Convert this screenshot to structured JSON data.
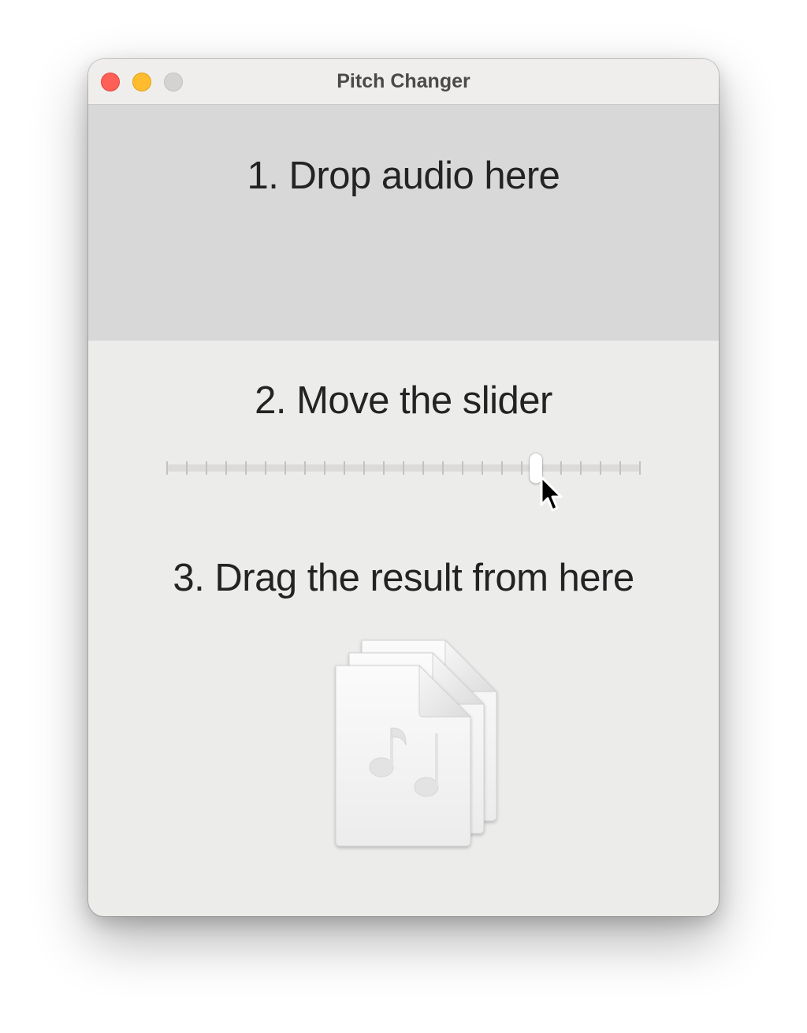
{
  "window": {
    "title": "Pitch Changer"
  },
  "dropzone": {
    "label": "1. Drop audio here"
  },
  "slider_section": {
    "label": "2. Move the slider",
    "tick_count": 25,
    "value_fraction": 0.78
  },
  "result_section": {
    "label": "3. Drag the result from here",
    "icon": "audio-files-icon"
  },
  "colors": {
    "close": "#fe5f57",
    "minimize": "#febc2e",
    "zoom_disabled": "#d4d3d2"
  }
}
